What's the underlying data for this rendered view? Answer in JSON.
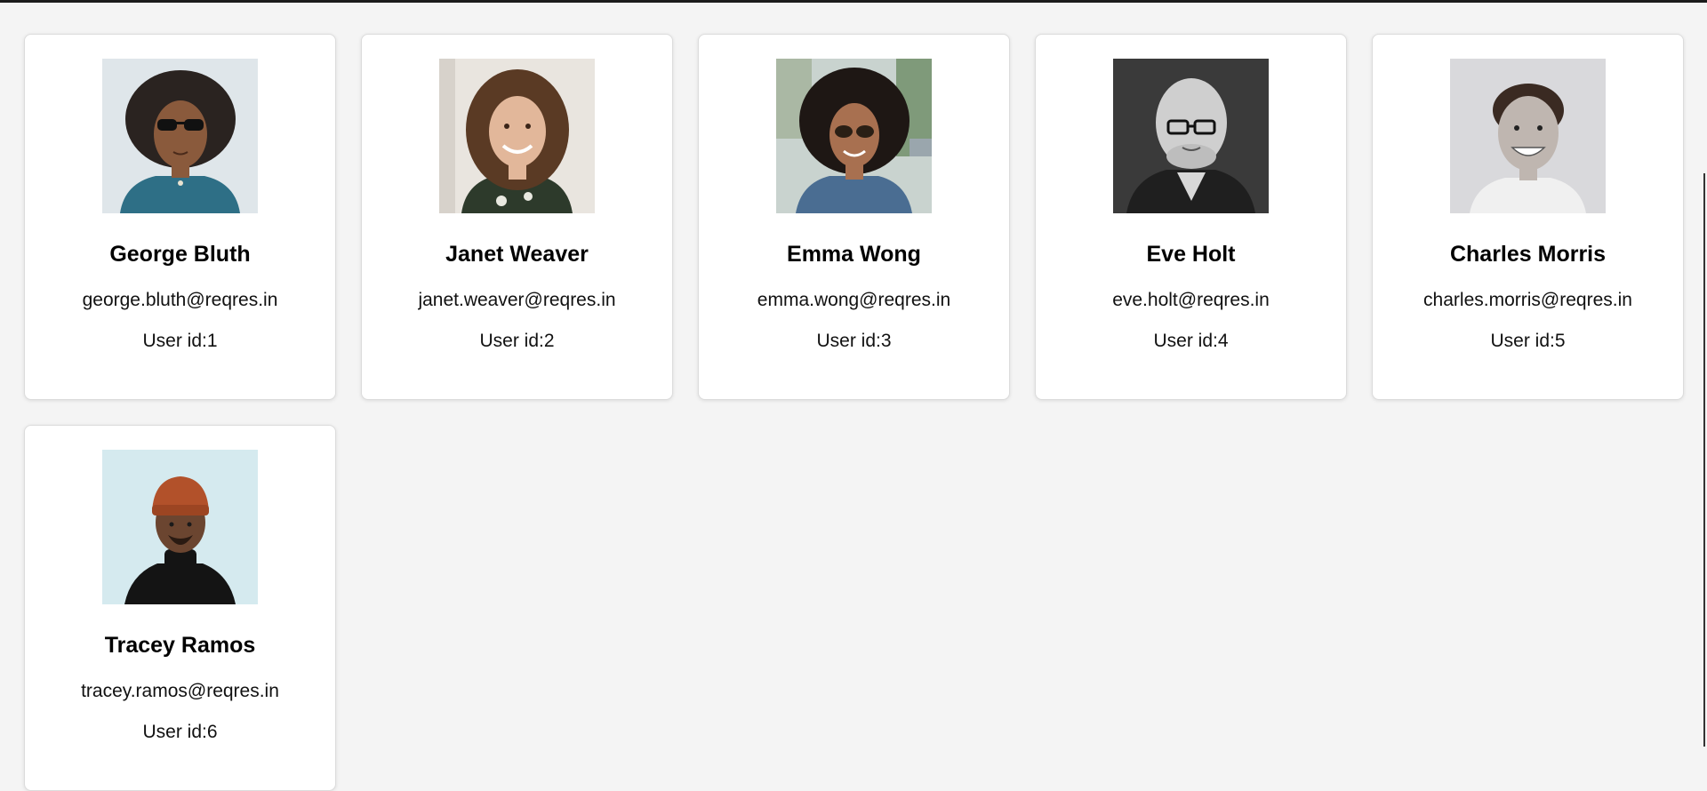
{
  "users": [
    {
      "name": "George Bluth",
      "email": "george.bluth@reqres.in",
      "id_text": "User id:1",
      "avatar_icon": "portrait-curly-hair-sunglasses"
    },
    {
      "name": "Janet Weaver",
      "email": "janet.weaver@reqres.in",
      "id_text": "User id:2",
      "avatar_icon": "portrait-woman-smiling"
    },
    {
      "name": "Emma Wong",
      "email": "emma.wong@reqres.in",
      "id_text": "User id:3",
      "avatar_icon": "portrait-woman-sunglasses-curly"
    },
    {
      "name": "Eve Holt",
      "email": "eve.holt@reqres.in",
      "id_text": "User id:4",
      "avatar_icon": "portrait-bald-man-glasses"
    },
    {
      "name": "Charles Morris",
      "email": "charles.morris@reqres.in",
      "id_text": "User id:5",
      "avatar_icon": "portrait-man-smiling"
    },
    {
      "name": "Tracey Ramos",
      "email": "tracey.ramos@reqres.in",
      "id_text": "User id:6",
      "avatar_icon": "portrait-man-orange-beanie"
    }
  ],
  "colors": {
    "background": "#f4f4f4",
    "card": "#ffffff",
    "text": "#000000"
  }
}
